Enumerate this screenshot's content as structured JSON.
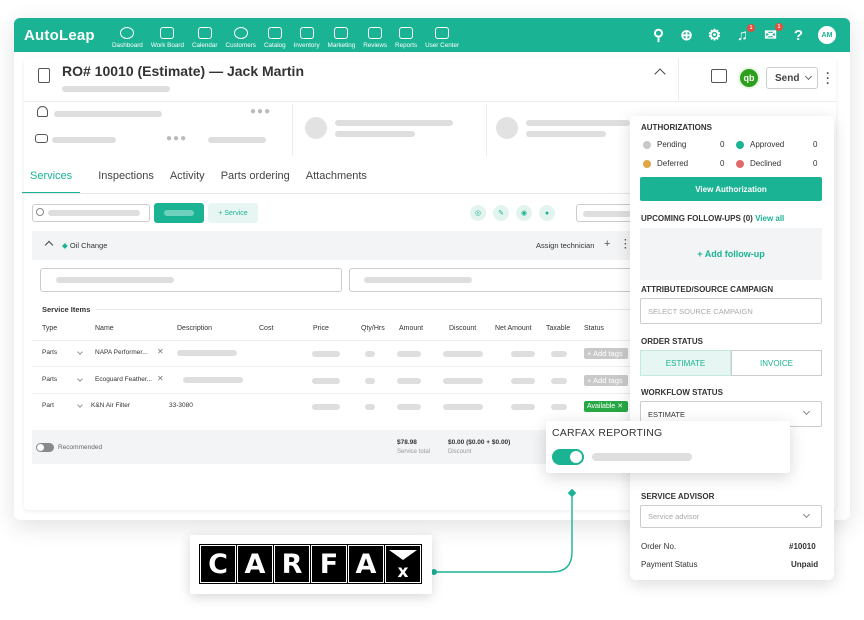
{
  "app": {
    "brand": "AutoLeap",
    "nav": [
      "Dashboard",
      "Work Board",
      "Calendar",
      "Customers",
      "Catalog",
      "Inventory",
      "Marketing",
      "Reviews",
      "Reports",
      "User Center"
    ],
    "user_initials": "AM",
    "notif_badge": "1",
    "chat_badge": "1",
    "accent": "#1ab394"
  },
  "ro": {
    "title": "RO# 10010 (Estimate) — Jack Martin",
    "send_label": "Send",
    "qb_label": "qb"
  },
  "tabs": [
    "Services",
    "Inspections",
    "Activity",
    "Parts ordering",
    "Attachments"
  ],
  "toolbar": {
    "service_label": "+ Service"
  },
  "service": {
    "name": "Oil Change",
    "assign_label": "Assign technician",
    "items_title": "Service Items",
    "columns": [
      "Type",
      "Name",
      "Description",
      "Cost",
      "Price",
      "Qty/Hrs",
      "Amount",
      "Discount",
      "Net Amount",
      "Taxable",
      "Status"
    ],
    "rows": [
      {
        "type": "Parts",
        "name": "NAPA Performer...",
        "description": "",
        "status": "+ Add tags"
      },
      {
        "type": "Parts",
        "name": "Ecoguard Feather...",
        "description": "",
        "status": "+ Add tags"
      },
      {
        "type": "Part",
        "name": "K&N Air Filter",
        "description": "33-3080",
        "status": "Available ✕"
      }
    ],
    "recommended_label": "Recommended",
    "total_value": "$78.98",
    "total_label": "Service total",
    "discount_value": "$0.00 ($0.00 + $0.00)",
    "discount_label": "Discount"
  },
  "panel": {
    "auth_title": "AUTHORIZATIONS",
    "pending_label": "Pending",
    "pending_count": "0",
    "approved_label": "Approved",
    "approved_count": "0",
    "deferred_label": "Deferred",
    "deferred_count": "0",
    "declined_label": "Declined",
    "declined_count": "0",
    "view_auth_label": "View Authorization",
    "followups_title": "UPCOMING FOLLOW-UPS (0)",
    "view_all_label": "View all",
    "add_followup_label": "+ Add follow-up",
    "campaign_title": "ATTRIBUTED/SOURCE CAMPAIGN",
    "campaign_placeholder": "SELECT SOURCE CAMPAIGN",
    "order_status_title": "ORDER STATUS",
    "order_status_estimate": "ESTIMATE",
    "order_status_invoice": "INVOICE",
    "workflow_title": "WORKFLOW STATUS",
    "workflow_value": "ESTIMATE",
    "advisor_title": "SERVICE ADVISOR",
    "advisor_placeholder": "Service advisor",
    "order_no_label": "Order No.",
    "order_no_value": "#10010",
    "payment_label": "Payment Status",
    "payment_value": "Unpaid"
  },
  "carfax": {
    "popup_title": "CARFAX REPORTING",
    "logo_letters": [
      "C",
      "A",
      "R",
      "F",
      "A"
    ]
  }
}
